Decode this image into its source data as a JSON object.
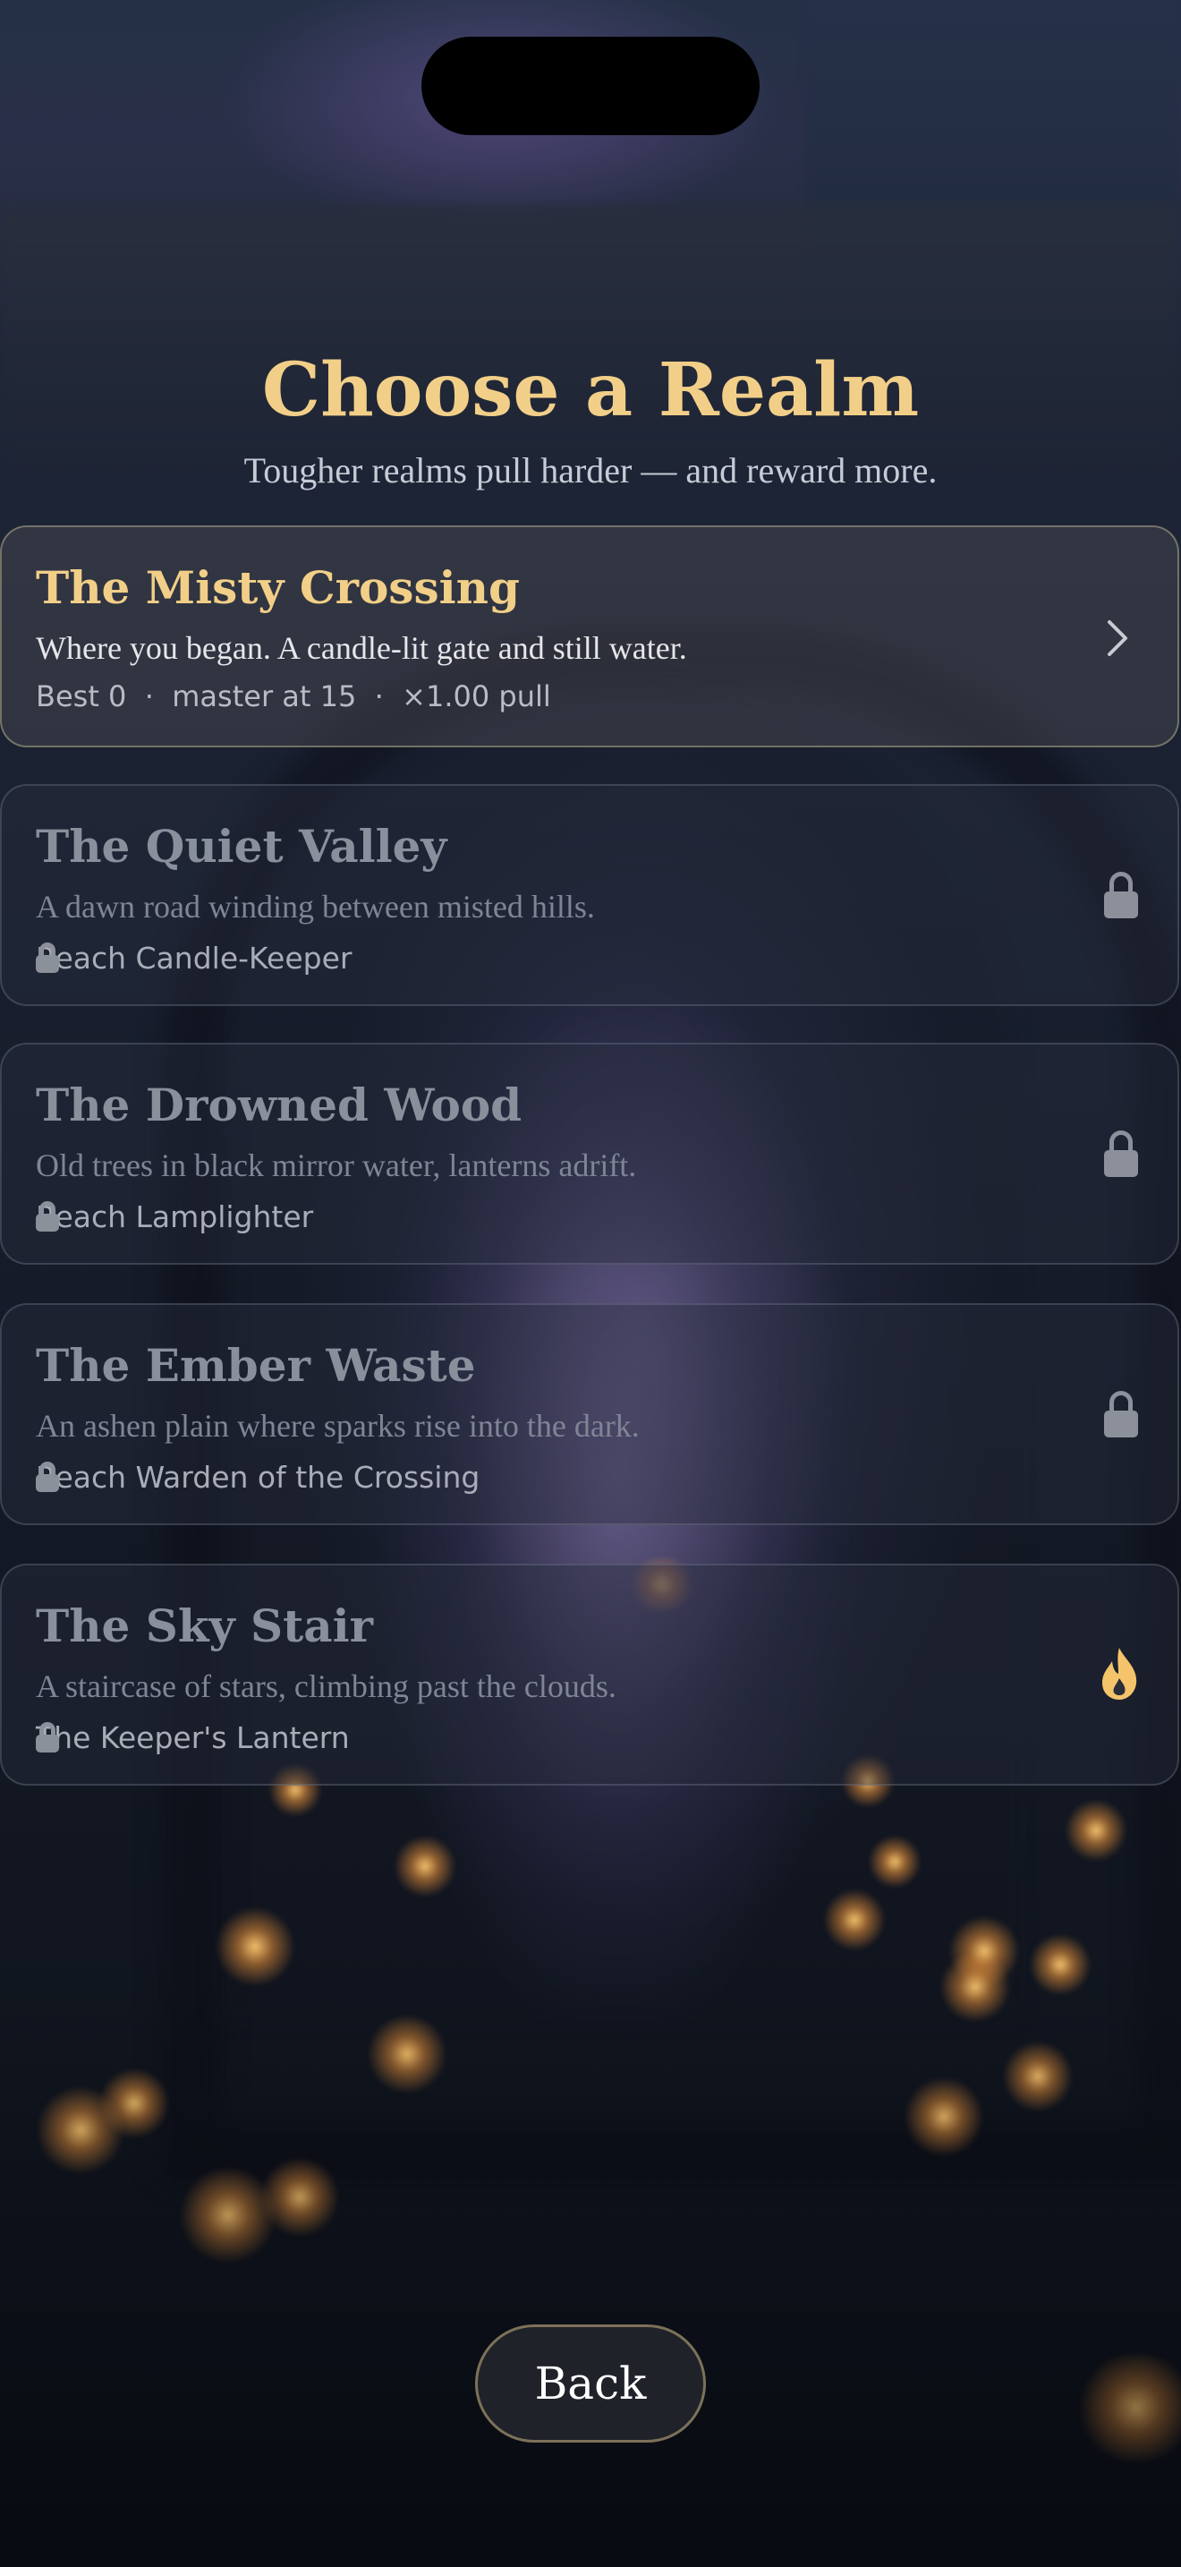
{
  "header": {
    "title": "Choose a Realm",
    "subtitle": "Tougher realms pull harder — and reward more."
  },
  "realms": [
    {
      "name": "The Misty Crossing",
      "description": "Where you began. A candle-lit gate and still water.",
      "meta": "Best 0  ·  master at 15  ·  ×1.00 pull",
      "status": "unlocked",
      "action_icon": "chevron-right-icon"
    },
    {
      "name": "The Quiet Valley",
      "description": "A dawn road winding between misted hills.",
      "requirement": "Reach Candle-Keeper",
      "status": "locked",
      "action_icon": "lock-icon"
    },
    {
      "name": "The Drowned Wood",
      "description": "Old trees in black mirror water, lanterns adrift.",
      "requirement": "Reach Lamplighter",
      "status": "locked",
      "action_icon": "lock-icon"
    },
    {
      "name": "The Ember Waste",
      "description": "An ashen plain where sparks rise into the dark.",
      "requirement": "Reach Warden of the Crossing",
      "status": "locked",
      "action_icon": "lock-icon"
    },
    {
      "name": "The Sky Stair",
      "description": "A staircase of stars, climbing past the clouds.",
      "requirement": "The Keeper's Lantern",
      "status": "locked",
      "action_icon": "flame-icon"
    }
  ],
  "footer": {
    "back_label": "Back"
  },
  "colors": {
    "accent_gold": "#f2cf88",
    "flame": "#f5c46a",
    "locked_text": "#8a8f9c"
  }
}
